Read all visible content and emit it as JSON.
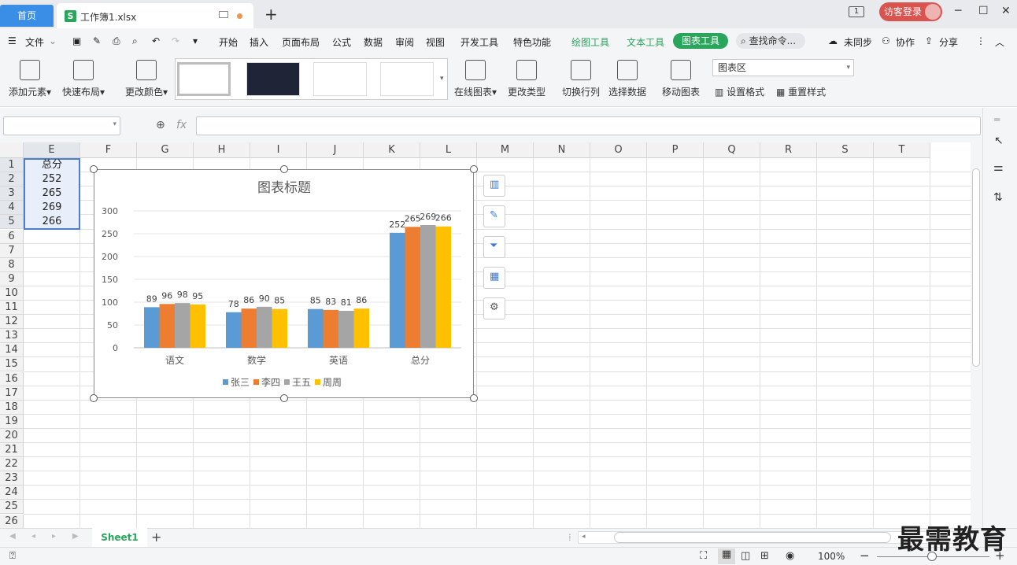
{
  "titlebar": {
    "home_tab": "首页",
    "doc_tab": "工作簿1.xlsx",
    "doc_icon": "S",
    "new_tab": "+",
    "page_count": "1",
    "login": "访客登录",
    "minimize": "─",
    "maximize": "☐",
    "close": "✕"
  },
  "menubar": {
    "file": "文件",
    "items": [
      "开始",
      "插入",
      "页面布局",
      "公式",
      "数据",
      "审阅",
      "视图",
      "开发工具",
      "特色功能"
    ],
    "context_tabs": [
      "绘图工具",
      "文本工具"
    ],
    "active_tab": "图表工具",
    "search": "查找命令...",
    "sync": "未同步",
    "collab": "协作",
    "share": "分享"
  },
  "ribbon": {
    "add_element": "添加元素",
    "quick_layout": "快速布局",
    "change_color": "更改颜色",
    "online_chart": "在线图表",
    "change_type": "更改类型",
    "switch_row_col": "切换行列",
    "select_data": "选择数据",
    "move_chart": "移动图表",
    "area_select": "图表区",
    "set_format": "设置格式",
    "reset_style": "重置样式"
  },
  "formula": {
    "fx": "fx",
    "name_value": "",
    "formula_value": ""
  },
  "sheet": {
    "columns": [
      "E",
      "F",
      "G",
      "H",
      "I",
      "J",
      "K",
      "L",
      "M",
      "N",
      "O",
      "P",
      "Q",
      "R",
      "S",
      "T"
    ],
    "rows": [
      "1",
      "2",
      "3",
      "4",
      "5",
      "6",
      "7",
      "8",
      "9",
      "10",
      "11",
      "12",
      "13",
      "14",
      "15",
      "16",
      "17",
      "18",
      "19",
      "20",
      "21",
      "22",
      "23",
      "24",
      "25",
      "26"
    ],
    "col_e_values": [
      "总分",
      "252",
      "265",
      "269",
      "266"
    ]
  },
  "chart_data": {
    "type": "bar",
    "title": "图表标题",
    "categories": [
      "语文",
      "数学",
      "英语",
      "总分"
    ],
    "series": [
      {
        "name": "张三",
        "color": "#5b9bd5",
        "values": [
          89,
          78,
          85,
          252
        ]
      },
      {
        "name": "李四",
        "color": "#ed7d31",
        "values": [
          96,
          86,
          83,
          265
        ]
      },
      {
        "name": "王五",
        "color": "#a5a5a5",
        "values": [
          98,
          90,
          81,
          269
        ]
      },
      {
        "name": "周周",
        "color": "#ffc000",
        "values": [
          95,
          85,
          86,
          266
        ]
      }
    ],
    "yticks": [
      "300",
      "250",
      "200",
      "150",
      "100",
      "50",
      "0"
    ],
    "ylim": [
      0,
      300
    ],
    "grid": true,
    "legend": "bottom"
  },
  "tabs": {
    "sheet1": "Sheet1",
    "add": "+"
  },
  "status": {
    "zoom": "100%",
    "zoom_minus": "−",
    "zoom_plus": "+"
  },
  "watermark": "最需教育"
}
